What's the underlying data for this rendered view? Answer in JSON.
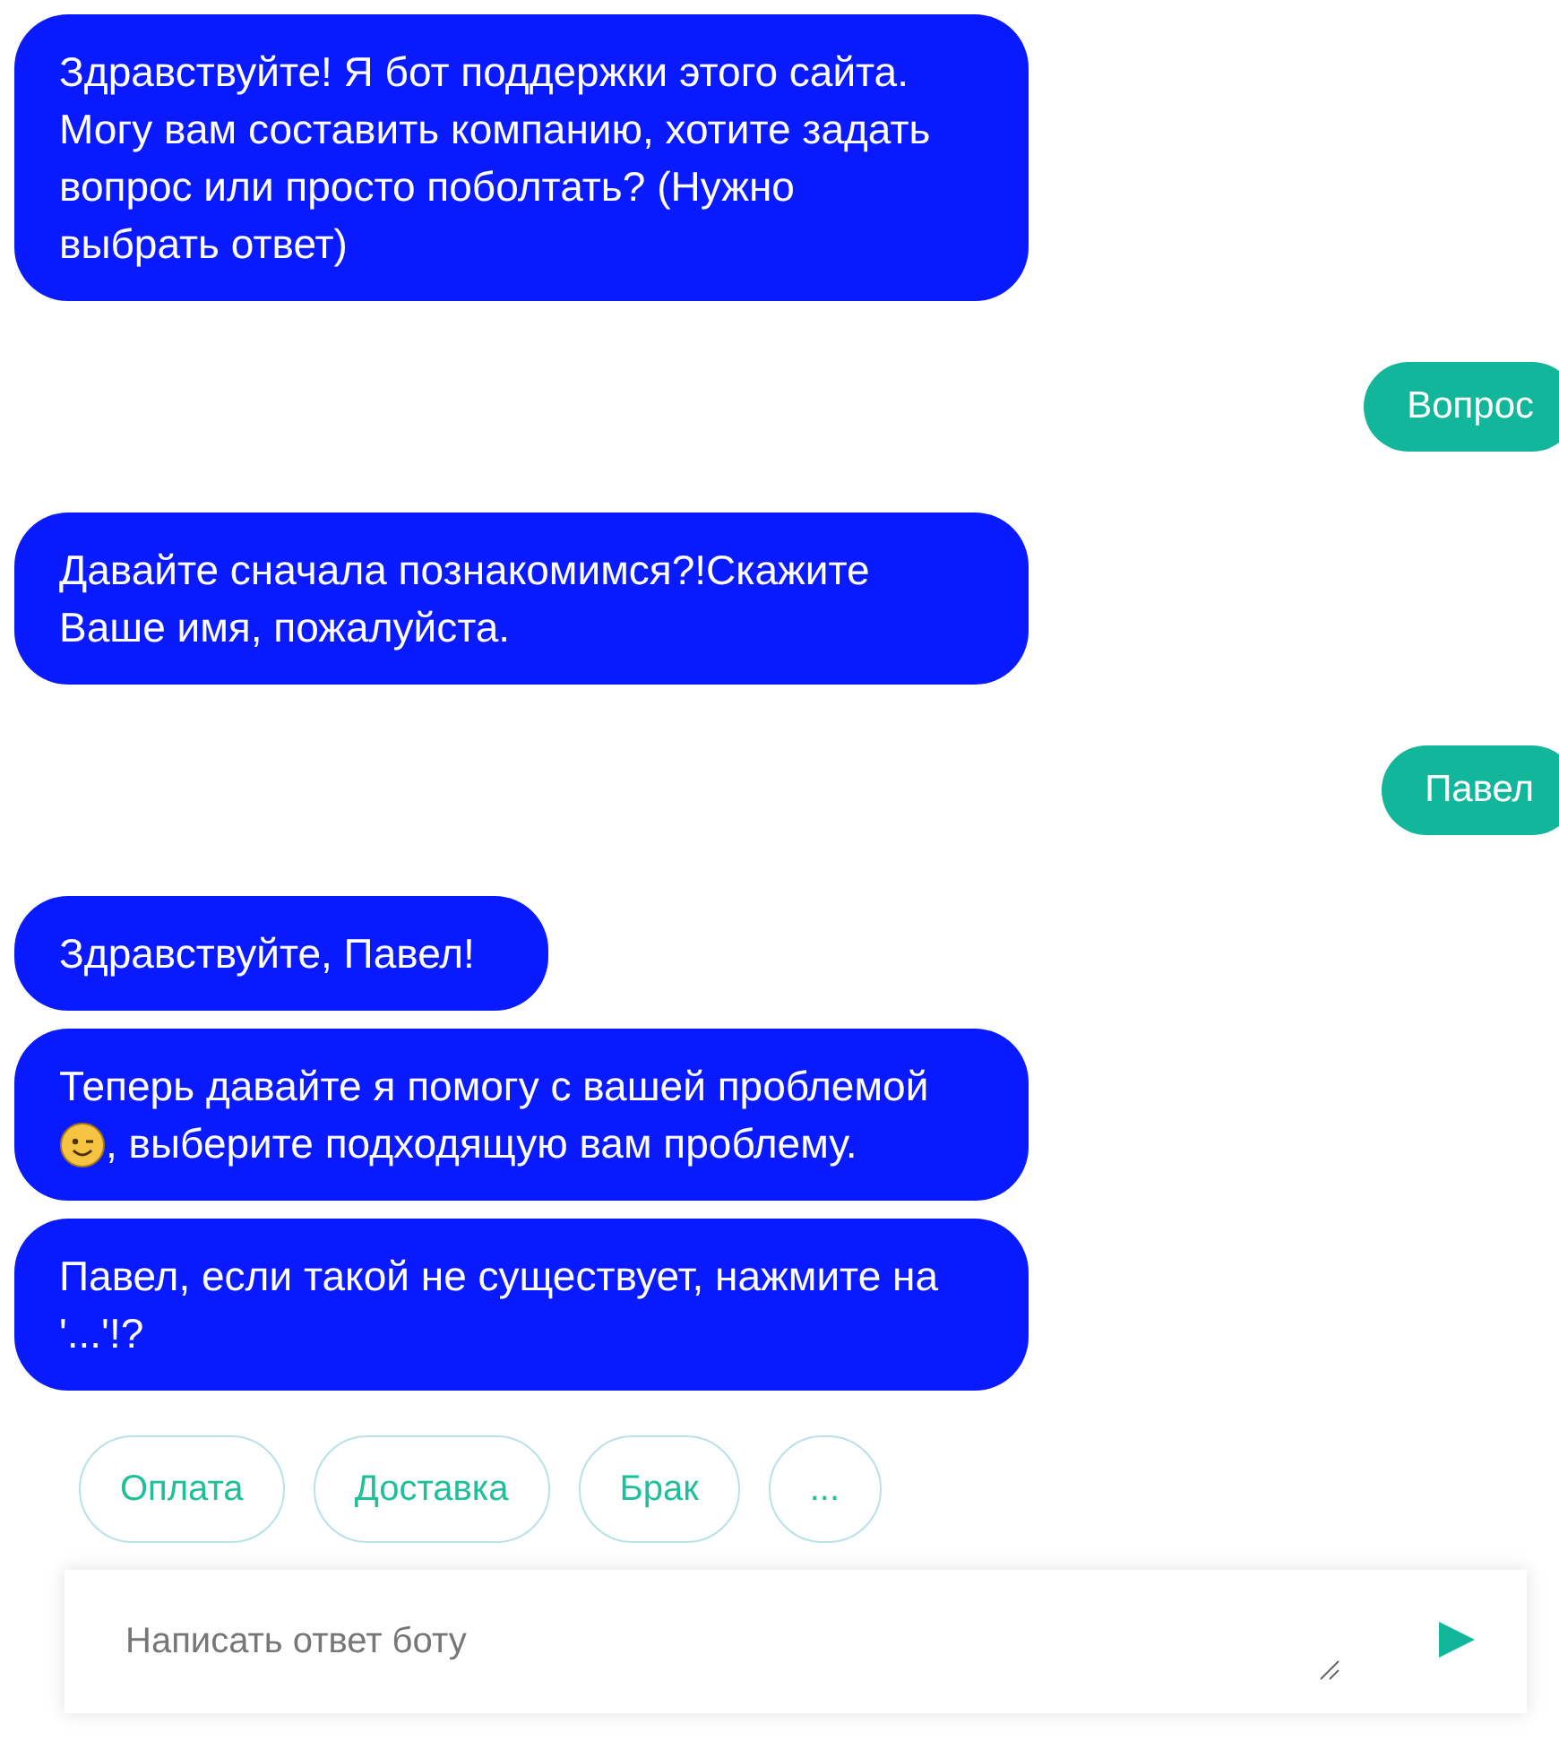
{
  "messages": [
    {
      "kind": "bot",
      "parts": [
        {
          "kind": "text",
          "text": "Здравствуйте! Я бот поддержки этого сайта. Могу вам составить компанию, хотите задать вопрос или просто поболтать? (Нужно выбрать ответ)"
        }
      ]
    },
    {
      "kind": "user",
      "parts": [
        {
          "kind": "text",
          "text": "Вопрос"
        }
      ]
    },
    {
      "kind": "bot",
      "parts": [
        {
          "kind": "text",
          "text": "Давайте сначала познакомимся?!Скажите Ваше имя, пожалуйста."
        }
      ]
    },
    {
      "kind": "user",
      "parts": [
        {
          "kind": "text",
          "text": "Павел"
        }
      ]
    },
    {
      "kind": "bot",
      "parts": [
        {
          "kind": "text",
          "text": "Здравствуйте, Павел!"
        }
      ]
    },
    {
      "kind": "bot",
      "parts": [
        {
          "kind": "text",
          "text": "Теперь давайте я помогу с вашей проблемой"
        },
        {
          "kind": "emoji"
        },
        {
          "kind": "text",
          "text": ", выберите подходящую вам проблему."
        }
      ]
    },
    {
      "kind": "bot",
      "parts": [
        {
          "kind": "text",
          "text": "Павел, если такой не существует, нажмите на '...'!?"
        }
      ]
    }
  ],
  "quick_replies": [
    "Оплата",
    "Доставка",
    "Брак",
    "..."
  ],
  "composer": {
    "placeholder": "Написать ответ боту"
  }
}
